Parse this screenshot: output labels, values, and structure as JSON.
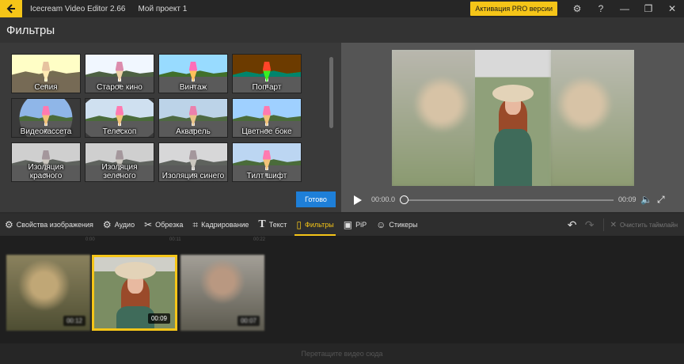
{
  "titlebar": {
    "app_name": "Icecream Video Editor 2.66",
    "project_name": "Мой проект 1",
    "pro_button": "Активация PRO версии"
  },
  "header": {
    "title": "Фильтры"
  },
  "filters": {
    "items": [
      {
        "label": "Сепия"
      },
      {
        "label": "Старое кино"
      },
      {
        "label": "Винтаж"
      },
      {
        "label": "Поп-арт"
      },
      {
        "label": "Видеокассета"
      },
      {
        "label": "Телескоп"
      },
      {
        "label": "Акварель"
      },
      {
        "label": "Цветное боке"
      },
      {
        "label": "Изоляция красного"
      },
      {
        "label": "Изоляция зеленого"
      },
      {
        "label": "Изоляция синего"
      },
      {
        "label": "Тилт шифт"
      }
    ],
    "done_button": "Готово"
  },
  "player": {
    "time_current": "00:00.0",
    "time_total": "00:09",
    "progress": 0
  },
  "toolbar": {
    "image_props": "Свойства изображения",
    "audio": "Аудио",
    "trim": "Обрезка",
    "crop": "Кадрирование",
    "text": "Текст",
    "filters": "Фильтры",
    "pip": "PiP",
    "stickers": "Стикеры",
    "clear_timeline": "Очистить таймлайн"
  },
  "timeline": {
    "ruler": [
      "0:00",
      "00:11",
      "00:22"
    ],
    "clips": [
      {
        "duration": "00:12"
      },
      {
        "duration": "00:09"
      },
      {
        "duration": "00:07"
      }
    ],
    "drop_hint": "Перетащите видео сюда"
  },
  "colors": {
    "accent": "#f5c518",
    "primary_button": "#1e7fd8"
  }
}
